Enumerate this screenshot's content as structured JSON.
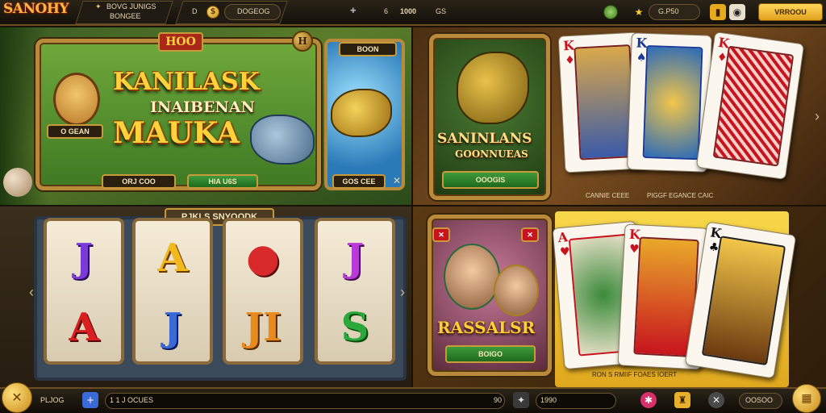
{
  "header": {
    "logo": "SANOHY",
    "subtitle_1": "BOVG JUNIGS",
    "subtitle_2": "BONGEE",
    "level_short": "D",
    "coin_label": "DOGEOG",
    "bet_value": "6",
    "win_value": "1000",
    "currency": "GS",
    "balance": "G.P50",
    "action_button": "VRROOU"
  },
  "panel_jungle": {
    "badge_top": "HOO",
    "title_1": "KANILASK",
    "title_2": "INAIBENAN",
    "title_3": "MAUKA",
    "avatar_label": "O GEAN",
    "tag_left": "ORJ COO",
    "tag_mid": "HIA U6S",
    "tag_right_top": "BOON",
    "tag_right_bottom": "GOS CEE",
    "round_badge": "H"
  },
  "panel_fish": {
    "title_1": "SANINLANS",
    "title_2": "GOONNUEAS",
    "play_button": "OOOGIS",
    "caption_1": "CANNIE CEEE",
    "caption_2": "PIGGF EGANCE CAIC"
  },
  "panel_slots": {
    "title": "PJKLS SNYOODK",
    "symbols": [
      [
        "J",
        "A"
      ],
      [
        "A",
        "J"
      ],
      [
        "●",
        "JI"
      ],
      [
        "J",
        "S"
      ]
    ]
  },
  "panel_cards": {
    "title": "RASSALSR",
    "play_button": "BOIGO",
    "caption": "RON S RMIIF FOAES IOERT",
    "cards": [
      {
        "rank": "A",
        "suit": "♥"
      },
      {
        "rank": "K",
        "suit": "♥"
      },
      {
        "rank": "K",
        "suit": "♣"
      }
    ]
  },
  "cards_top": [
    {
      "rank": "K",
      "suit": "♦"
    },
    {
      "rank": "K",
      "suit": "♠"
    },
    {
      "rank": "K",
      "suit": "♦"
    }
  ],
  "footer": {
    "label": "PLJOG",
    "field_value": "1 1 J OCUES",
    "field_count": "90",
    "amount": "1990",
    "menu_label": "OOSOO"
  },
  "colors": {
    "accent_gold": "#ffd23b",
    "frame_gold": "#b98a3a",
    "button_green": "#3f9a3a",
    "card_red": "#c8141e"
  }
}
